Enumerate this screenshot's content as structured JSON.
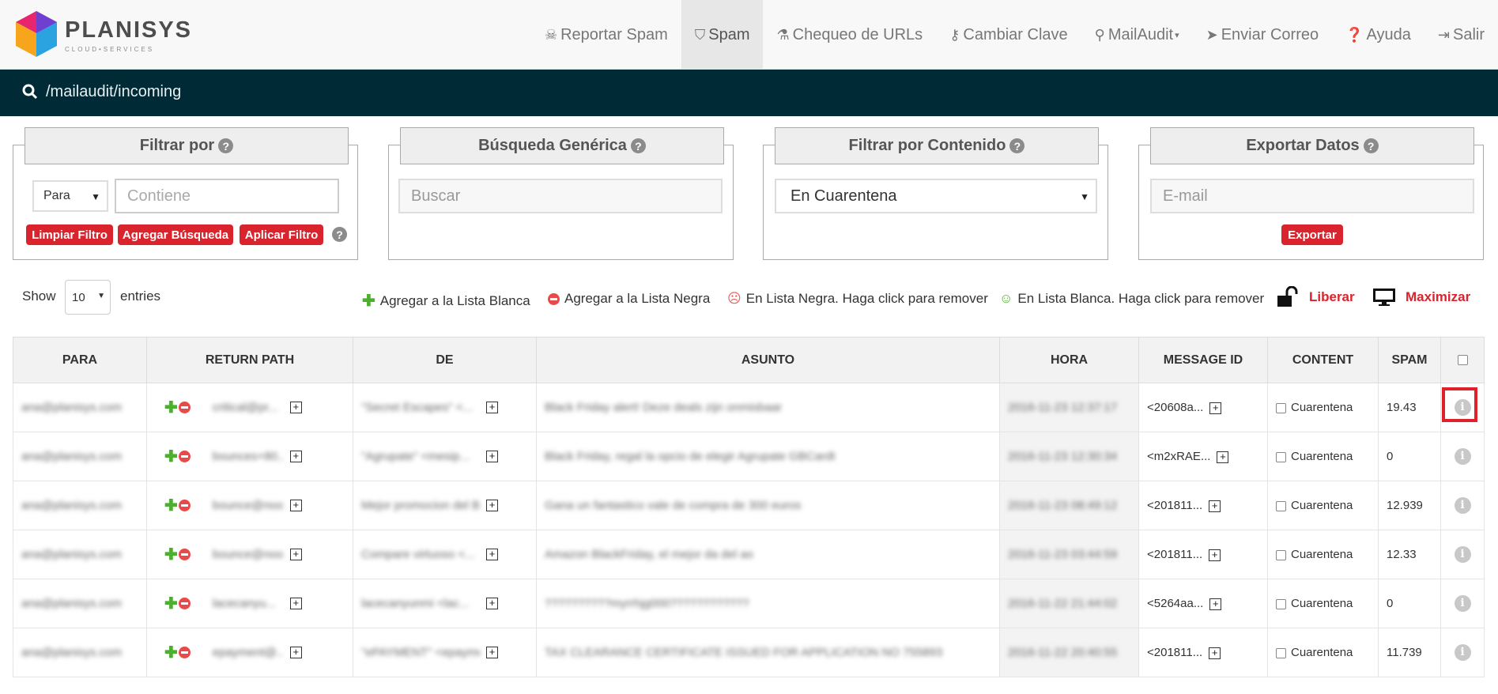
{
  "brand": {
    "name": "PLANISYS",
    "tagline": "CLOUD•SERVICES",
    "colors": [
      "#e8266d",
      "#6f3fd1",
      "#2aa3e0",
      "#f7a51c"
    ]
  },
  "nav": [
    {
      "label": "Reportar Spam",
      "icon": "skull-icon"
    },
    {
      "label": "Spam",
      "icon": "shield-icon",
      "active": true
    },
    {
      "label": "Chequeo de URLs",
      "icon": "flask-icon"
    },
    {
      "label": "Cambiar Clave",
      "icon": "key-icon"
    },
    {
      "label": "MailAudit",
      "icon": "search-icon",
      "dropdown": true
    },
    {
      "label": "Enviar Correo",
      "icon": "paper-plane-icon"
    },
    {
      "label": "Ayuda",
      "icon": "question-circle-icon"
    },
    {
      "label": "Salir",
      "icon": "sign-out-icon"
    }
  ],
  "pathbar": {
    "path": "/mailaudit/incoming"
  },
  "filters": {
    "filtrar_por": {
      "title": "Filtrar por",
      "select_value": "Para",
      "input_placeholder": "Contiene",
      "btn_clear": "Limpiar Filtro",
      "btn_add": "Agregar Búsqueda",
      "btn_apply": "Aplicar Filtro"
    },
    "busqueda": {
      "title": "Búsqueda Genérica",
      "input_placeholder": "Buscar"
    },
    "contenido": {
      "title": "Filtrar por Contenido",
      "select_value": "En Cuarentena"
    },
    "exportar": {
      "title": "Exportar Datos",
      "input_placeholder": "E-mail",
      "btn_export": "Exportar"
    }
  },
  "toolbar": {
    "show_label": "Show",
    "entries_value": "10",
    "entries_label": "entries",
    "whitelist_add": "Agregar a la Lista Blanca",
    "blacklist_add": "Agregar a la Lista Negra",
    "in_blacklist": "En Lista Negra. Haga click para remover",
    "in_whitelist": "En Lista Blanca. Haga click para remover",
    "liberar": "Liberar",
    "maximizar": "Maximizar"
  },
  "table": {
    "headers": [
      "PARA",
      "RETURN PATH",
      "DE",
      "ASUNTO",
      "HORA",
      "MESSAGE ID",
      "CONTENT",
      "SPAM"
    ],
    "rows": [
      {
        "para": "ana@planisys.com",
        "return_path": "critical@pr...",
        "de": "\"Secret Escapes\" <...",
        "asunto": "Black Friday alert! Deze deals zijn onmisbaar",
        "hora": "2016-11-23 12:37:17",
        "message_id": "<20608a...",
        "content": "Cuarentena",
        "spam": "19.43"
      },
      {
        "para": "ana@planisys.com",
        "return_path": "bounces+80...",
        "de": "\"Agrupate\" <mesip...",
        "asunto": "Black Friday, regal la opcio de elegir Agrupate GBCardt",
        "hora": "2016-11-23 12:30:34",
        "message_id": "<m2xRAE...",
        "content": "Cuarentena",
        "spam": "0"
      },
      {
        "para": "ana@planisys.com",
        "return_path": "bounce@noo...",
        "de": "Mejor promocion del B...",
        "asunto": "Gana un fantastico vale de compra de 300 euros",
        "hora": "2016-11-23 08:49:12",
        "message_id": "<201811...",
        "content": "Cuarentena",
        "spam": "12.939"
      },
      {
        "para": "ana@planisys.com",
        "return_path": "bounce@noo...",
        "de": "Compare virtuoso <...",
        "asunto": "Amazon BlackFriday, el mejor da del ao",
        "hora": "2016-11-23 03:44:59",
        "message_id": "<201811...",
        "content": "Cuarentena",
        "spam": "12.33"
      },
      {
        "para": "ana@planisys.com",
        "return_path": "lacecanyu...",
        "de": "lacecanyunmi <lac...",
        "asunto": "??????????myrrhjg000????????????",
        "hora": "2016-11-22 21:44:02",
        "message_id": "<5264aa...",
        "content": "Cuarentena",
        "spam": "0"
      },
      {
        "para": "ana@planisys.com",
        "return_path": "epayment@...",
        "de": "\"ePAYMENT\" <epayme...",
        "asunto": "TAX CLEARANCE CERTIFICATE ISSUED FOR APPLICATION NO 755893",
        "hora": "2016-11-22 20:40:55",
        "message_id": "<201811...",
        "content": "Cuarentena",
        "spam": "11.739"
      }
    ]
  }
}
